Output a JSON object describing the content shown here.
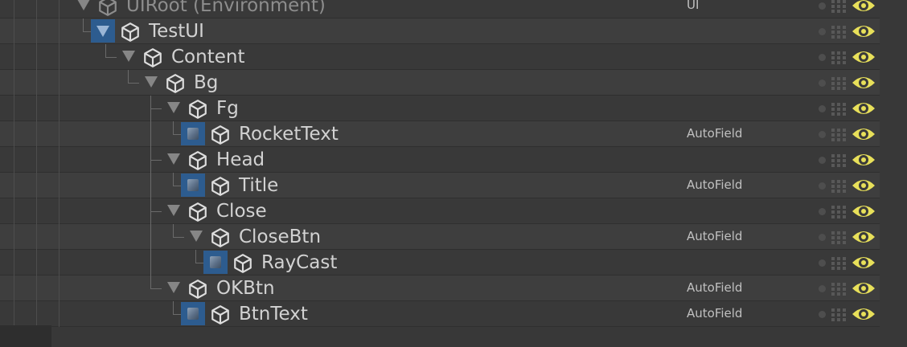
{
  "hierarchy": {
    "rows": [
      {
        "name": "UIRoot (Environment)",
        "tag": "UI"
      },
      {
        "name": "TestUI",
        "tag": ""
      },
      {
        "name": "Content",
        "tag": ""
      },
      {
        "name": "Bg",
        "tag": ""
      },
      {
        "name": "Fg",
        "tag": ""
      },
      {
        "name": "RocketText",
        "tag": "AutoField"
      },
      {
        "name": "Head",
        "tag": ""
      },
      {
        "name": "Title",
        "tag": "AutoField"
      },
      {
        "name": "Close",
        "tag": ""
      },
      {
        "name": "CloseBtn",
        "tag": "AutoField"
      },
      {
        "name": "RayCast",
        "tag": ""
      },
      {
        "name": "OKBtn",
        "tag": "AutoField"
      },
      {
        "name": "BtnText",
        "tag": "AutoField"
      }
    ]
  },
  "icons": {
    "node": "cube-icon",
    "visibility": "eye-icon",
    "pickable": "pick-grid-icon",
    "prefab": "prefab-icon",
    "expand": "expand-arrow-icon"
  },
  "colors": {
    "background": "#383838",
    "selection_blue": "#2d5c8f",
    "eye": "#e8e05a",
    "text": "#d2d2d2"
  }
}
